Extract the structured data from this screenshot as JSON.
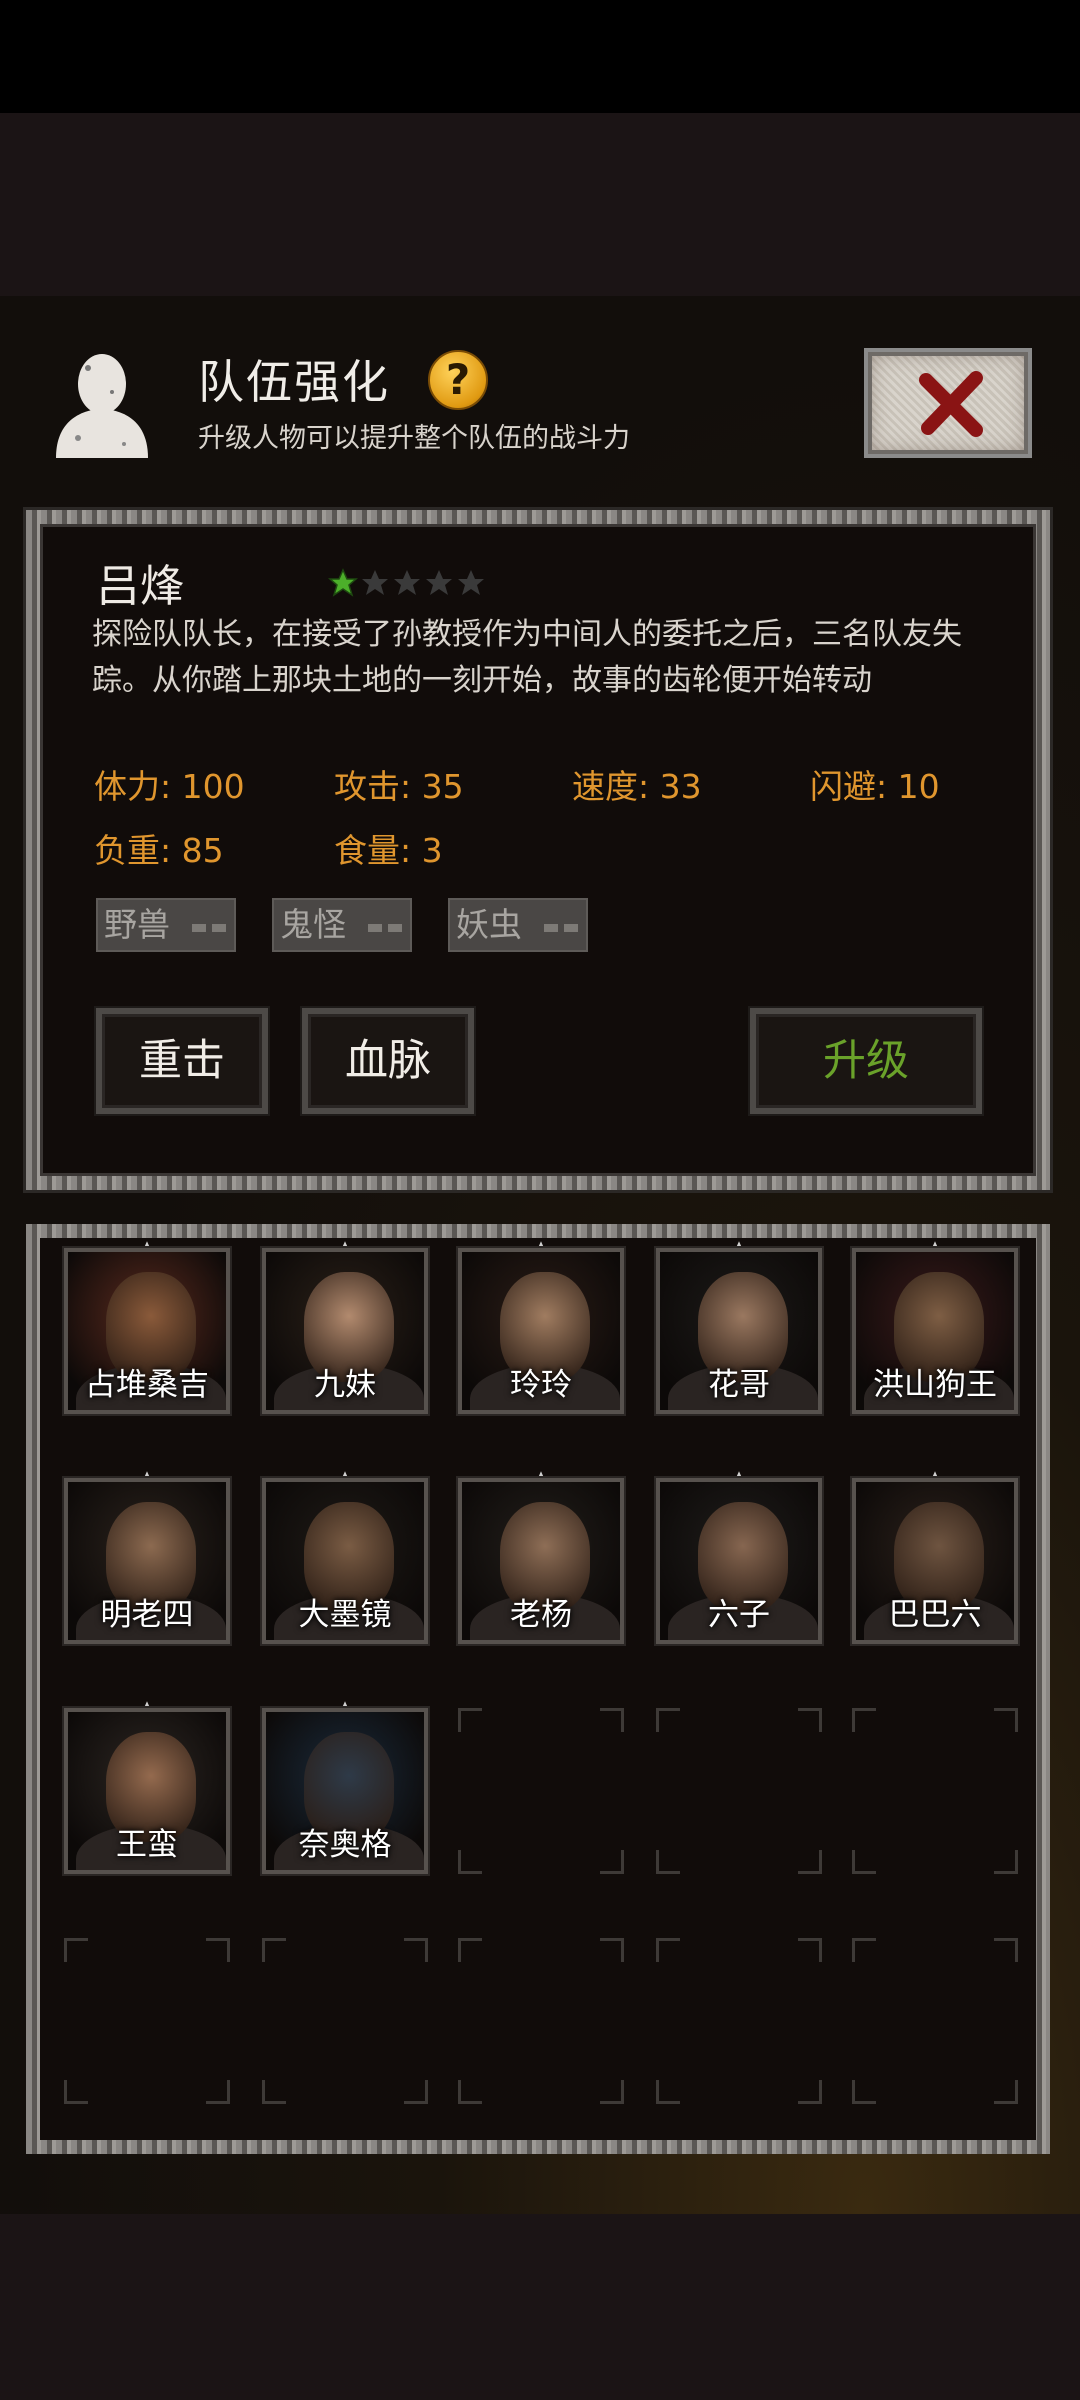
{
  "header": {
    "title": "队伍强化",
    "subtitle": "升级人物可以提升整个队伍的战斗力",
    "help_icon": "question-icon",
    "close_icon": "close-x-icon"
  },
  "character": {
    "name": "吕烽",
    "star_rating": 1,
    "star_max": 5,
    "description": "探险队队长，在接受了孙教授作为中间人的委托之后，三名队友失踪。从你踏上那块土地的一刻开始，故事的齿轮便开始转动",
    "stats": [
      {
        "label": "体力: 100"
      },
      {
        "label": "攻击: 35"
      },
      {
        "label": "速度: 33"
      },
      {
        "label": "闪避: 10"
      },
      {
        "label": "负重: 85"
      },
      {
        "label": "食量: 3"
      }
    ],
    "tags": [
      "野兽",
      "鬼怪",
      "妖虫"
    ]
  },
  "buttons": {
    "heavy_strike": "重击",
    "bloodline": "血脉",
    "upgrade": "升级"
  },
  "roster": [
    {
      "name": "占堆桑吉"
    },
    {
      "name": "九妹"
    },
    {
      "name": "玲玲"
    },
    {
      "name": "花哥"
    },
    {
      "name": "洪山狗王"
    },
    {
      "name": "明老四"
    },
    {
      "name": "大墨镜"
    },
    {
      "name": "老杨"
    },
    {
      "name": "六子"
    },
    {
      "name": "巴巴六"
    },
    {
      "name": "王蛮"
    },
    {
      "name": "奈奥格"
    }
  ],
  "colors": {
    "stat_text": "#e0962e",
    "upgrade_text": "#6aa22a",
    "star_active": "#4caf2a",
    "star_inactive": "#3a3a3a"
  }
}
